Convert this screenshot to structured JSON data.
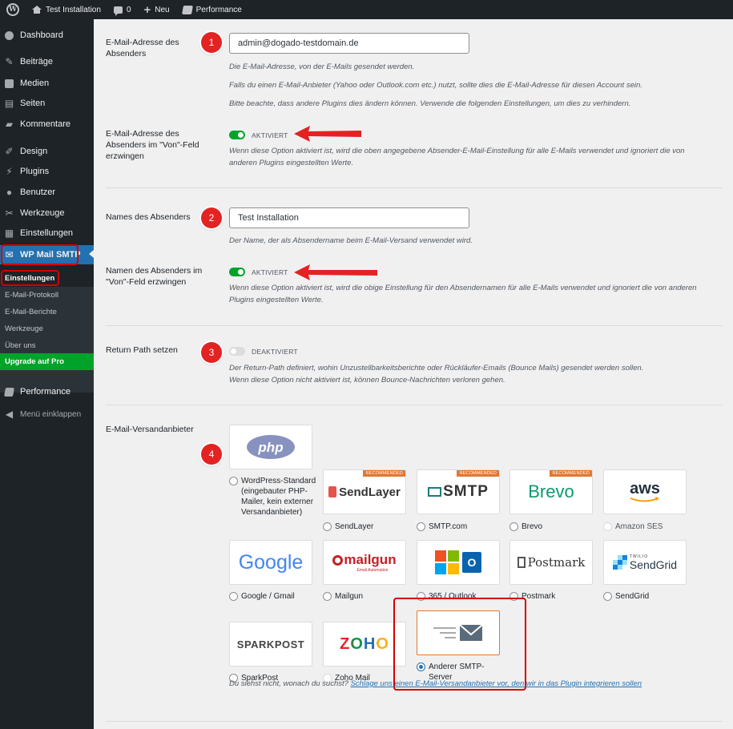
{
  "adminbar": {
    "site_name": "Test Installation",
    "comments_count": "0",
    "new_label": "Neu",
    "performance_label": "Performance"
  },
  "sidebar": {
    "items": [
      {
        "label": "Dashboard"
      },
      {
        "label": "Beiträge"
      },
      {
        "label": "Medien"
      },
      {
        "label": "Seiten"
      },
      {
        "label": "Kommentare"
      },
      {
        "label": "Design"
      },
      {
        "label": "Plugins"
      },
      {
        "label": "Benutzer"
      },
      {
        "label": "Werkzeuge"
      },
      {
        "label": "Einstellungen"
      },
      {
        "label": "WP Mail SMTP"
      }
    ],
    "submenu": [
      {
        "label": "Einstellungen"
      },
      {
        "label": "E-Mail-Protokoll"
      },
      {
        "label": "E-Mail-Berichte"
      },
      {
        "label": "Werkzeuge"
      },
      {
        "label": "Über uns"
      }
    ],
    "upgrade_label": "Upgrade auf Pro",
    "performance_label": "Performance",
    "collapse_label": "Menü einklappen"
  },
  "settings": {
    "from_email": {
      "label": "E-Mail-Adresse des Absenders",
      "value": "admin@dogado-testdomain.de",
      "desc1": "Die E-Mail-Adresse, von der E-Mails gesendet werden.",
      "desc2": "Falls du einen E-Mail-Anbieter (Yahoo oder Outlook.com etc.) nutzt, sollte dies die E-Mail-Adresse für diesen Account sein.",
      "desc3": "Bitte beachte, dass andere Plugins dies ändern können. Verwende die folgenden Einstellungen, um dies zu verhindern."
    },
    "force_email": {
      "label": "E-Mail-Adresse des Absenders im \"Von\"-Feld erzwingen",
      "state": "AKTIVIERT",
      "desc": "Wenn diese Option aktiviert ist, wird die oben angegebene Absender-E-Mail-Einstellung für alle E-Mails verwendet und ignoriert die von anderen Plugins eingestellten Werte."
    },
    "from_name": {
      "label": "Names des Absenders",
      "value": "Test Installation",
      "desc": "Der Name, der als Absendername beim E-Mail-Versand verwendet wird."
    },
    "force_name": {
      "label": "Namen des Absenders im \"Von\"-Feld erzwingen",
      "state": "AKTIVIERT",
      "desc": "Wenn diese Option aktiviert ist, wird die obige Einstellung für den Absendernamen für alle E-Mails verwendet und ignoriert die von anderen Plugins eingestellten Werte."
    },
    "return_path": {
      "label": "Return Path setzen",
      "state": "DEAKTIVIERT",
      "desc1": "Der Return-Path definiert, wohin Unzustellbarkeitsberichte oder Rückläufer-Emails (Bounce Mails) gesendet werden sollen.",
      "desc2": "Wenn diese Option nicht aktiviert ist, können Bounce-Nachrichten verloren gehen."
    },
    "mailer": {
      "label": "E-Mail-Versandanbieter",
      "recommended": "RECOMMENDED",
      "options": [
        {
          "label": "WordPress-Standard (eingebauter PHP-Mailer, kein externer Versandanbieter)",
          "logo": "php"
        },
        {
          "label": "SendLayer",
          "logo": "SendLayer"
        },
        {
          "label": "SMTP.com",
          "logo": "SMTP"
        },
        {
          "label": "Brevo",
          "logo": "Brevo"
        },
        {
          "label": "Amazon SES",
          "logo": "aws"
        },
        {
          "label": "Google / Gmail",
          "logo": "Google"
        },
        {
          "label": "Mailgun",
          "logo": "mailgun"
        },
        {
          "label": "365 / Outlook",
          "logo": ""
        },
        {
          "label": "Postmark",
          "logo": "Postmark"
        },
        {
          "label": "SendGrid",
          "logo": "SendGrid"
        },
        {
          "label": "SparkPost",
          "logo": "SPARKPOST"
        },
        {
          "label": "Zoho Mail",
          "logo": "ZOHO"
        },
        {
          "label": "Anderer SMTP-Server",
          "logo": ""
        }
      ],
      "logo_subtexts": {
        "mailgun": "Email Automation",
        "sendgrid": "TWILIO"
      },
      "footer_text": "Du siehst nicht, wonach du suchst?",
      "footer_link": "Schlage uns einen E-Mail-Versandanbieter vor, den wir in das Plugin integrieren sollen"
    }
  },
  "annotations": [
    "1",
    "2",
    "3",
    "4"
  ],
  "colors": {
    "toggle_on": "#00a32a",
    "accent": "#2271b1",
    "annotation_red": "#e32222",
    "recommended": "#e27730"
  }
}
